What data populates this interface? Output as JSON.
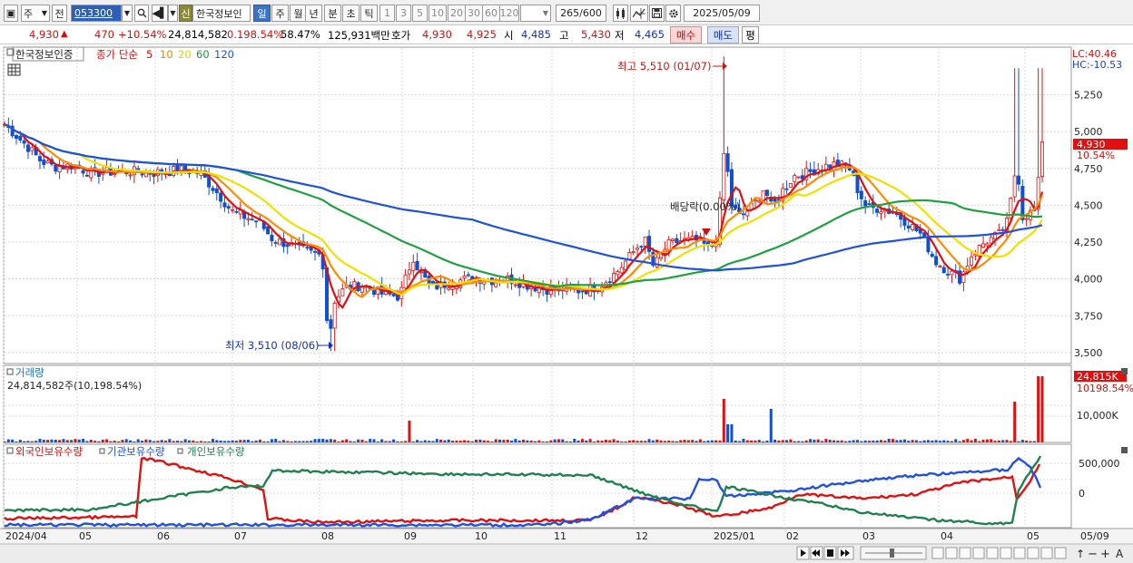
{
  "toolbar": {
    "period_type": "주",
    "prev_label": "전",
    "code": "053300",
    "sin_badge": "신",
    "stock_name": "한국정보인",
    "tabs": [
      "일",
      "주",
      "월",
      "년",
      "분",
      "초",
      "틱"
    ],
    "active_tab_index": 0,
    "numbers": [
      "1",
      "3",
      "5",
      "10",
      "20",
      "30",
      "60",
      "120"
    ],
    "count_display": "265/600",
    "date": "2025/05/09"
  },
  "quote": {
    "price": "4,930",
    "change": "470",
    "change_pct": "+10.54%",
    "volume": "24,814,582",
    "volume_ratio": "0.198.54%",
    "turnover_pct": "58.47%",
    "amount": "125,931백만",
    "hoga_label": "호가",
    "ask": "4,930",
    "bid": "4,925",
    "open_label": "시",
    "open": "4,485",
    "high_label": "고",
    "high": "5,430",
    "low_label": "저",
    "low": "4,465",
    "buy_label": "매수",
    "sell_label": "매도",
    "avg_label": "평"
  },
  "price_pane": {
    "stock_label": "한국정보인증",
    "indicator_label": "종가 단순",
    "ma_periods": [
      "5",
      "10",
      "20",
      "60",
      "120"
    ],
    "lc_label": "LC:40.46",
    "hc_label": "HC:-10.53",
    "current_price_label": "4,930",
    "current_change_label": "10.54%",
    "high_annotation": "최고 5,510 (01/07)",
    "low_annotation": "최저 3,510 (08/06)",
    "dividend_annotation": "배당락(0.00%)"
  },
  "volume_pane": {
    "title": "거래량",
    "value_label": "24,814,582주(10,198.54%)",
    "current_label": "24,815K",
    "current_pct": "10198.54%",
    "axis_label": "10,000K"
  },
  "holdings_pane": {
    "series_labels": [
      "외국인보유수량",
      "기관보유수량",
      "개인보유수량"
    ],
    "axis_labels": [
      "500,000",
      "0"
    ]
  },
  "x_axis": {
    "labels": [
      "2024/04",
      "05",
      "06",
      "07",
      "08",
      "09",
      "10",
      "11",
      "12",
      "2025/01",
      "02",
      "03",
      "04",
      "05",
      "05/09"
    ]
  },
  "chart_data": {
    "type": "line",
    "title": "",
    "price_axis": {
      "ticks": [
        3500,
        3750,
        4000,
        4250,
        4500,
        4750,
        5000,
        5250
      ],
      "ylim": [
        3450,
        5450
      ]
    },
    "volume_axis": {
      "ticks": [
        "10,000K"
      ]
    },
    "holdings_axis": {
      "ticks": [
        "500,000",
        "0"
      ]
    },
    "series": [
      {
        "name": "5",
        "color": "#e01010"
      },
      {
        "name": "10",
        "color": "#ff8c00"
      },
      {
        "name": "20",
        "color": "#f0e000"
      },
      {
        "name": "60",
        "color": "#20a040"
      },
      {
        "name": "120",
        "color": "#2050e0"
      }
    ],
    "holdings_series": [
      {
        "name": "외국인보유수량",
        "color": "#e01010"
      },
      {
        "name": "기관보유수량",
        "color": "#2050e0"
      },
      {
        "name": "개인보유수량",
        "color": "#208050"
      }
    ],
    "extremes": {
      "high": 5510,
      "high_date": "01/07",
      "low": 3510,
      "low_date": "08/06"
    },
    "last_close": 4930
  }
}
